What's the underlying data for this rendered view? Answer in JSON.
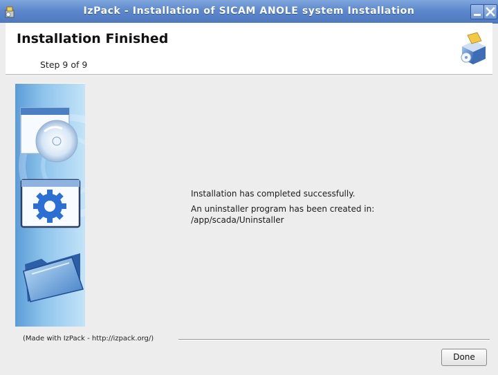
{
  "window": {
    "title": "IzPack - Installation of SICAM ANOLE system Installation"
  },
  "header": {
    "title": "Installation Finished",
    "step": "Step 9 of 9"
  },
  "content": {
    "line1": "Installation has completed successfully.",
    "line2": "An uninstaller program has been created in:",
    "line3": "/app/scada/Uninstaller"
  },
  "footer": {
    "made_with": "(Made with IzPack - http://izpack.org/)",
    "done_label": "Done"
  },
  "icons": {
    "app": "installer-app-icon",
    "minimize": "minimize-icon",
    "close": "close-icon",
    "header_logo": "installer-package-icon",
    "side": [
      "disc-icon",
      "gear-icon",
      "folder-icon"
    ]
  },
  "colors": {
    "titlebar": "#5d88cc",
    "side_panel": "#8ec4ec"
  }
}
